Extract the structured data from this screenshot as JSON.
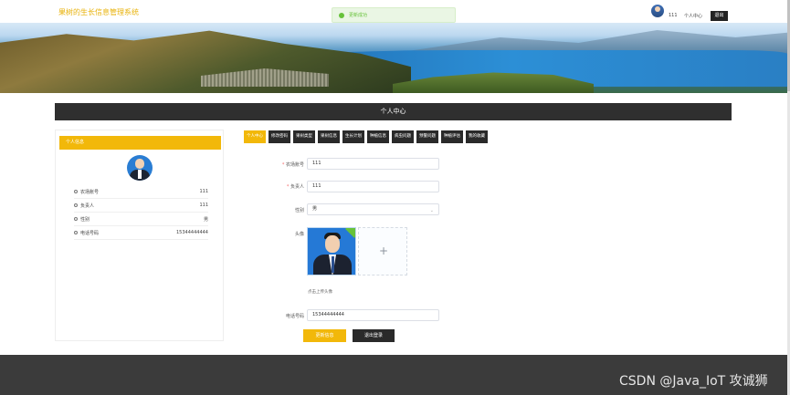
{
  "header": {
    "site_title": "果树的生长信息管理系统",
    "user_name": "111",
    "personal_center": "个人中心",
    "logout": "退出"
  },
  "toast": {
    "message": "更新成功"
  },
  "section_title": "个人中心",
  "profile_card": {
    "title": "个人信息",
    "rows": [
      {
        "label": "农场账号",
        "value": "111"
      },
      {
        "label": "负责人",
        "value": "111"
      },
      {
        "label": "性别",
        "value": "男"
      },
      {
        "label": "电话号码",
        "value": "15344444444"
      }
    ]
  },
  "tabs": [
    {
      "label": "个人中心",
      "active": true
    },
    {
      "label": "修改密码",
      "active": false
    },
    {
      "label": "果树类型",
      "active": false
    },
    {
      "label": "果树信息",
      "active": false
    },
    {
      "label": "生长计划",
      "active": false
    },
    {
      "label": "种植信息",
      "active": false
    },
    {
      "label": "病虫问题",
      "active": false
    },
    {
      "label": "预警问题",
      "active": false
    },
    {
      "label": "种植评估",
      "active": false
    },
    {
      "label": "我的收藏",
      "active": false
    }
  ],
  "form": {
    "account_label": "农场账号",
    "account_value": "111",
    "manager_label": "负责人",
    "manager_value": "111",
    "gender_label": "性别",
    "gender_value": "男",
    "photo_label": "头像",
    "upload_hint": "点击上传头像",
    "phone_label": "电话号码",
    "phone_value": "15344444444",
    "update_button": "更新信息",
    "logout_button": "退出登录"
  },
  "watermark": "CSDN @Java_IoT 攻诚狮",
  "colors": {
    "accent": "#f2b80a",
    "dark": "#2a2a2a",
    "success": "#67c23a"
  }
}
